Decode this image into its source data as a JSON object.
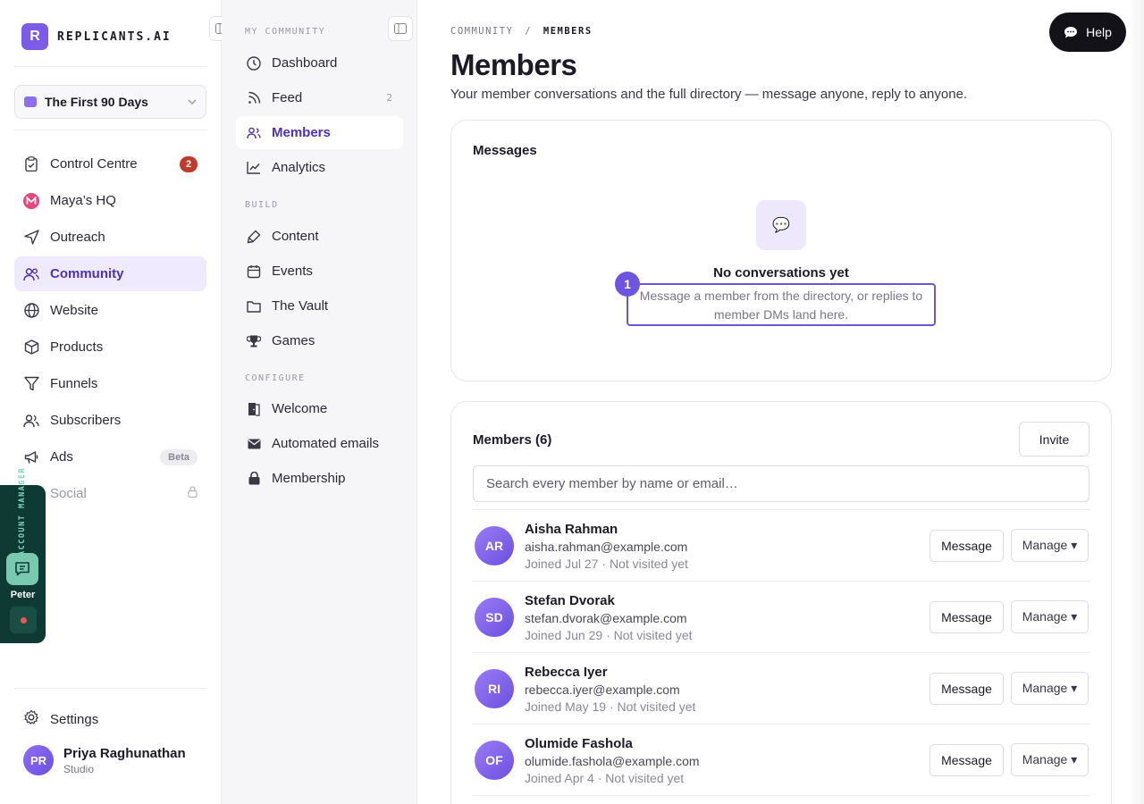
{
  "brand": {
    "logo_letter": "R",
    "name": "REPLICANTS.AI"
  },
  "workspace": {
    "label": "The First 90 Days"
  },
  "nav": {
    "items": [
      {
        "label": "Control Centre",
        "icon": "clipboard-icon",
        "badge": "2"
      },
      {
        "label": "Maya’s HQ",
        "icon": "maya-logo-icon"
      },
      {
        "label": "Outreach",
        "icon": "send-icon"
      },
      {
        "label": "Community",
        "icon": "users-icon",
        "active": true
      },
      {
        "label": "Website",
        "icon": "globe-icon"
      },
      {
        "label": "Products",
        "icon": "box-icon"
      },
      {
        "label": "Funnels",
        "icon": "funnel-icon"
      },
      {
        "label": "Subscribers",
        "icon": "subscribers-icon"
      },
      {
        "label": "Ads",
        "icon": "megaphone-icon",
        "tag": "Beta"
      },
      {
        "label": "Social",
        "icon": "lock-icon",
        "locked": true
      }
    ],
    "settings_label": "Settings"
  },
  "user": {
    "initials": "PR",
    "name": "Priya Raghunathan",
    "plan": "Studio"
  },
  "account_manager": {
    "label": "ACCOUNT MANAGER",
    "name": "Peter"
  },
  "subnav": {
    "section_my_community": "MY COMMUNITY",
    "section_build": "BUILD",
    "section_configure": "CONFIGURE",
    "items_my_community": [
      {
        "label": "Dashboard",
        "icon": "clock-icon"
      },
      {
        "label": "Feed",
        "icon": "rss-icon",
        "count": "2"
      },
      {
        "label": "Members",
        "icon": "members-icon",
        "active": true
      },
      {
        "label": "Analytics",
        "icon": "chart-icon"
      }
    ],
    "items_build": [
      {
        "label": "Content",
        "icon": "brush-icon"
      },
      {
        "label": "Events",
        "icon": "calendar-icon"
      },
      {
        "label": "The Vault",
        "icon": "folder-icon"
      },
      {
        "label": "Games",
        "icon": "trophy-icon"
      }
    ],
    "items_configure": [
      {
        "label": "Welcome",
        "icon": "door-icon"
      },
      {
        "label": "Automated emails",
        "icon": "mail-icon"
      },
      {
        "label": "Membership",
        "icon": "lock-icon"
      }
    ]
  },
  "header": {
    "breadcrumb_root": "COMMUNITY",
    "breadcrumb_sep": "/",
    "breadcrumb_current": "MEMBERS",
    "title": "Members",
    "subtitle": "Your member conversations and the full directory — message anyone, reply to anyone.",
    "help_label": "Help"
  },
  "messages": {
    "title": "Messages",
    "empty_icon": "💬",
    "empty_title": "No conversations yet",
    "empty_desc": "Message a member from the directory, or replies to member DMs land here.",
    "step": "1"
  },
  "directory": {
    "title": "Members (6)",
    "invite_label": "Invite",
    "search_placeholder": "Search every member by name or email…",
    "message_label": "Message",
    "manage_label": "Manage ▾",
    "members": [
      {
        "initials": "AR",
        "name": "Aisha Rahman",
        "email": "aisha.rahman@example.com",
        "meta": "Joined Jul 27 · Not visited yet"
      },
      {
        "initials": "SD",
        "name": "Stefan Dvorak",
        "email": "stefan.dvorak@example.com",
        "meta": "Joined Jun 29 · Not visited yet"
      },
      {
        "initials": "RI",
        "name": "Rebecca Iyer",
        "email": "rebecca.iyer@example.com",
        "meta": "Joined May 19 · Not visited yet"
      },
      {
        "initials": "OF",
        "name": "Olumide Fashola",
        "email": "olumide.fashola@example.com",
        "meta": "Joined Apr 4 · Not visited yet"
      }
    ]
  }
}
